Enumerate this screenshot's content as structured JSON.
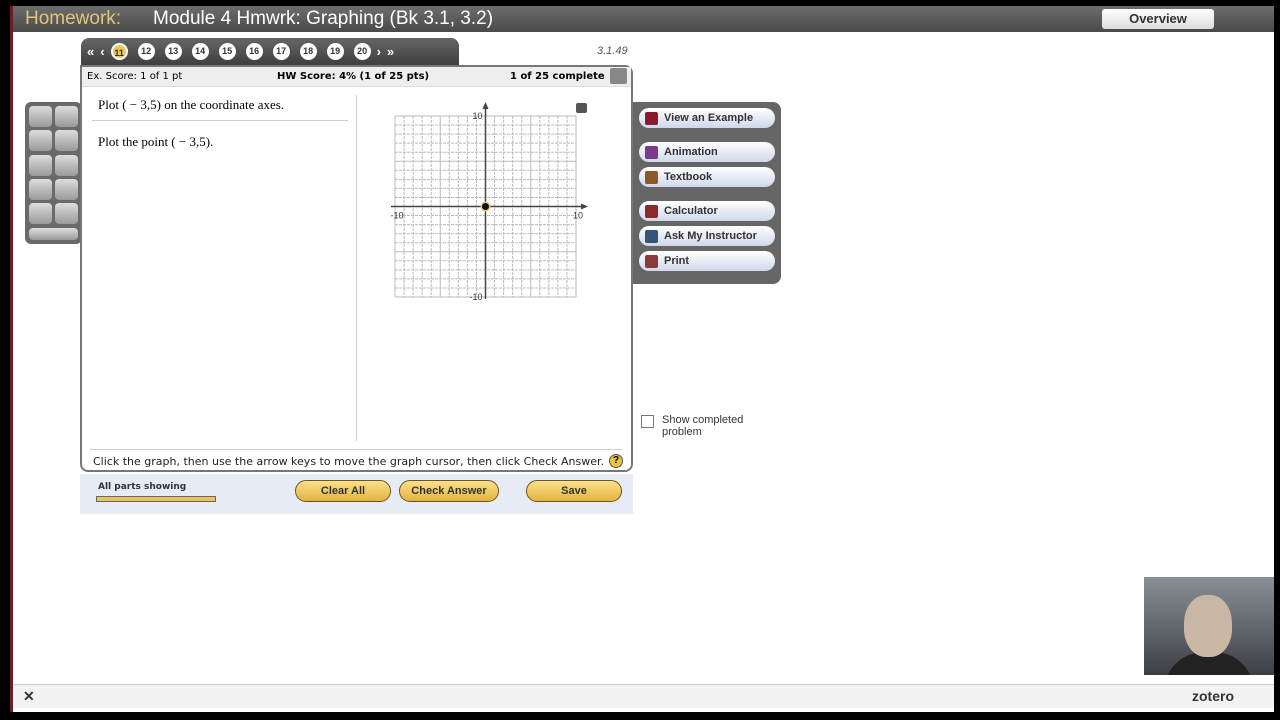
{
  "header": {
    "section": "Homework:",
    "title": "Module 4 Hmwrk: Graphing (Bk 3.1, 3.2)",
    "overview": "Overview"
  },
  "nav": {
    "first": "«",
    "prev": "‹",
    "next": "›",
    "last": "»",
    "questions": [
      "11",
      "12",
      "13",
      "14",
      "15",
      "16",
      "17",
      "18",
      "19",
      "20"
    ],
    "current": "11",
    "section_number": "3.1.49"
  },
  "scores": {
    "ex_score": "Ex. Score: 1 of 1 pt",
    "hw_score": "HW Score: 4% (1 of 25 pts)",
    "complete": "1 of 25 complete"
  },
  "question": {
    "prompt": "Plot ( − 3,5) on the coordinate axes.",
    "instruction": "Plot the point ( − 3,5)."
  },
  "graph": {
    "xmin": -10,
    "xmax": 10,
    "ymin": -10,
    "ymax": 10,
    "labels": {
      "xmin": "-10",
      "xmax": "10",
      "ymin": "-10",
      "ymax": "10"
    },
    "cursor": [
      0,
      0
    ]
  },
  "help_text": "Click the graph, then use the arrow keys to move the graph cursor, then click Check Answer.",
  "help_icon": "?",
  "tools": [
    {
      "label": "View an Example",
      "color": "#8b1a2b"
    },
    {
      "label": "Animation",
      "color": "#7a3a8a"
    },
    {
      "label": "Textbook",
      "color": "#8a5a2a"
    },
    {
      "label": "Calculator",
      "color": "#8b2a2a"
    },
    {
      "label": "Ask My Instructor",
      "color": "#335577"
    },
    {
      "label": "Print",
      "color": "#8b3a3a"
    }
  ],
  "show_completed": "Show completed problem",
  "bottom": {
    "all_parts": "All parts showing",
    "parts_progress": 1.0,
    "clear_all": "Clear All",
    "check_answer": "Check Answer",
    "save": "Save"
  },
  "footer": {
    "close": "✕",
    "zotero": "zotero"
  }
}
